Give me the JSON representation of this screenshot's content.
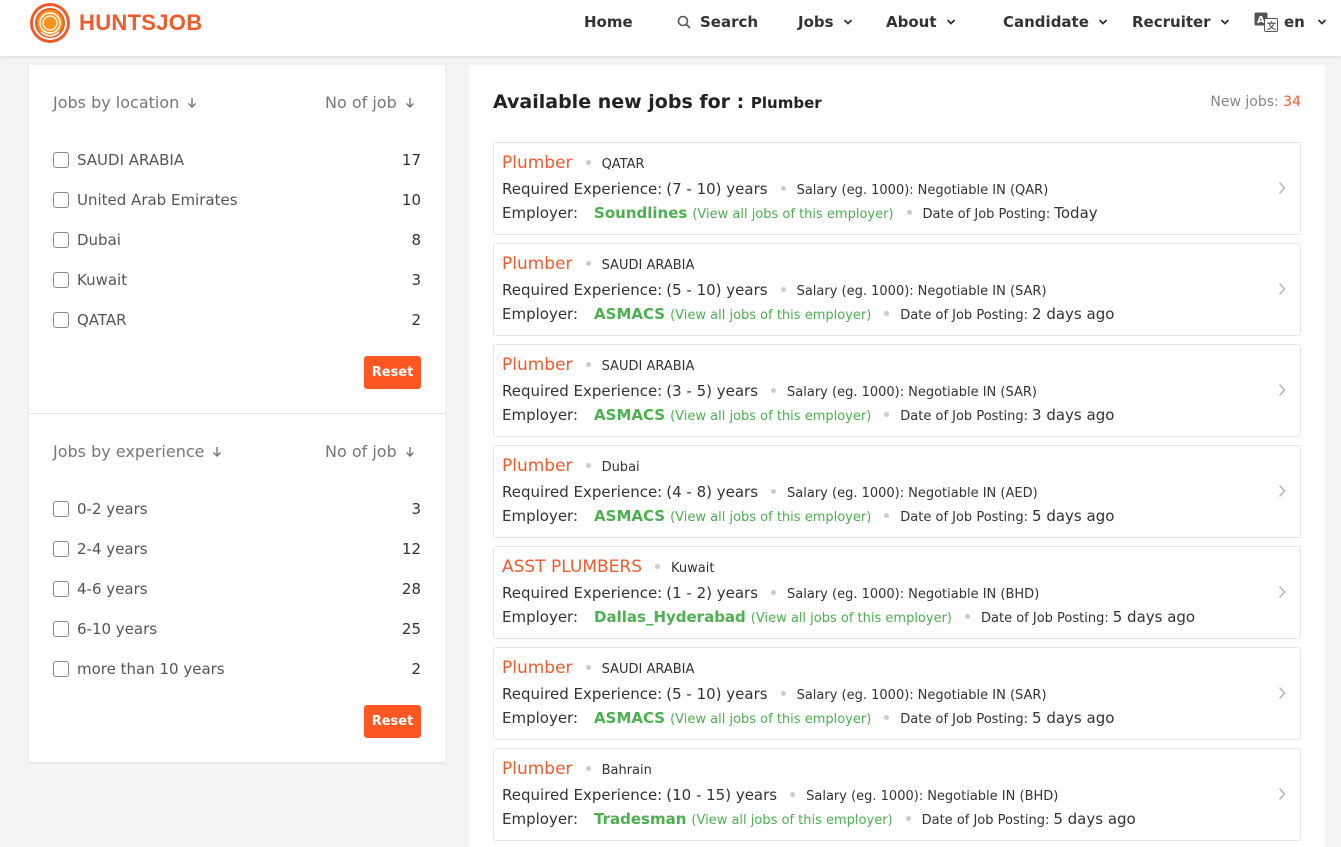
{
  "brand": {
    "name": "HUNTSJOB",
    "accent": "#f15a2b",
    "green": "#4caf50"
  },
  "nav": {
    "home": "Home",
    "search": "Search",
    "jobs": "Jobs",
    "about": "About",
    "candidate": "Candidate",
    "recruiter": "Recruiter",
    "lang": "en"
  },
  "location_filter": {
    "heading": "Jobs by location",
    "count_heading": "No of job",
    "items": [
      {
        "label": "SAUDI ARABIA",
        "count": "17"
      },
      {
        "label": "United Arab Emirates",
        "count": "10"
      },
      {
        "label": "Dubai",
        "count": "8"
      },
      {
        "label": "Kuwait",
        "count": "3"
      },
      {
        "label": "QATAR",
        "count": "2"
      }
    ],
    "reset": "Reset"
  },
  "experience_filter": {
    "heading": "Jobs by experience",
    "count_heading": "No of job",
    "items": [
      {
        "label": "0-2 years",
        "count": "3"
      },
      {
        "label": "2-4 years",
        "count": "12"
      },
      {
        "label": "4-6 years",
        "count": "28"
      },
      {
        "label": "6-10 years",
        "count": "25"
      },
      {
        "label": "more than 10 years",
        "count": "2"
      }
    ],
    "reset": "Reset"
  },
  "main": {
    "title": "Available new jobs for :",
    "keyword": "Plumber",
    "new_jobs_label": "New jobs:",
    "new_jobs_count": "34"
  },
  "labels": {
    "experience": "Required Experience:",
    "salary": "Salary (eg. 1000):",
    "employer": "Employer:",
    "view_all": "(View all jobs of this employer)",
    "date": "Date of Job Posting:"
  },
  "jobs": [
    {
      "title": "Plumber",
      "location": "QATAR",
      "experience": "(7 - 10) years",
      "salary": "Negotiable IN (QAR)",
      "employer": "Soundlines",
      "date": "Today"
    },
    {
      "title": "Plumber",
      "location": "SAUDI ARABIA",
      "experience": "(5 - 10) years",
      "salary": "Negotiable IN (SAR)",
      "employer": "ASMACS",
      "date": "2 days ago"
    },
    {
      "title": "Plumber",
      "location": "SAUDI ARABIA",
      "experience": "(3 - 5) years",
      "salary": "Negotiable IN (SAR)",
      "employer": "ASMACS",
      "date": "3 days ago"
    },
    {
      "title": "Plumber",
      "location": "Dubai",
      "experience": "(4 - 8) years",
      "salary": "Negotiable IN (AED)",
      "employer": "ASMACS",
      "date": "5 days ago"
    },
    {
      "title": "ASST PLUMBERS",
      "location": "Kuwait",
      "experience": "(1 - 2) years",
      "salary": "Negotiable IN (BHD)",
      "employer": "Dallas_Hyderabad",
      "date": "5 days ago"
    },
    {
      "title": "Plumber",
      "location": "SAUDI ARABIA",
      "experience": "(5 - 10) years",
      "salary": "Negotiable IN (SAR)",
      "employer": "ASMACS",
      "date": "5 days ago"
    },
    {
      "title": "Plumber",
      "location": "Bahrain",
      "experience": "(10 - 15) years",
      "salary": "Negotiable IN (BHD)",
      "employer": "Tradesman",
      "date": "5 days ago"
    }
  ]
}
